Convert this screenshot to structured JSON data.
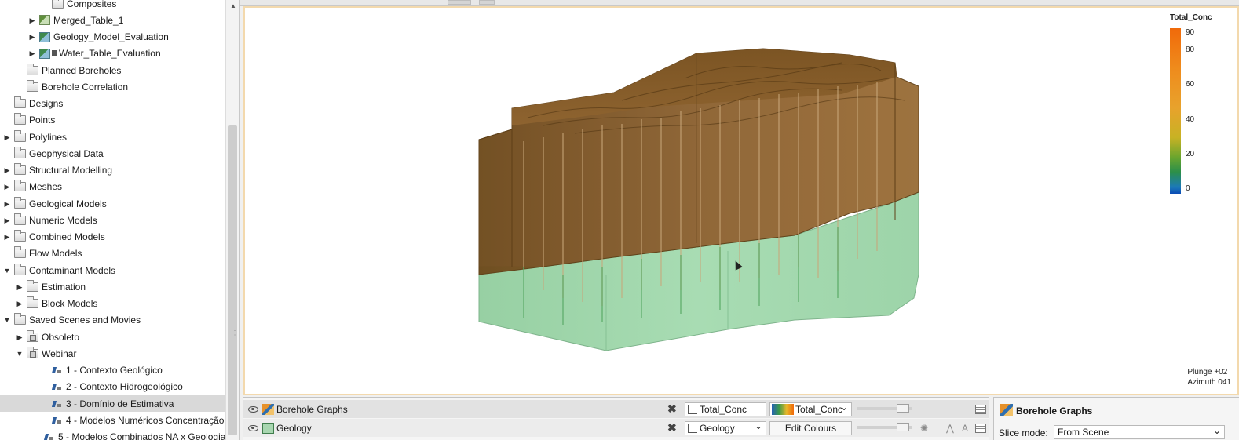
{
  "tree": {
    "items": [
      {
        "label": "Composites",
        "indent": 3,
        "arrow": "",
        "icon": "folder"
      },
      {
        "label": "Merged_Table_1",
        "indent": 2,
        "arrow": "▶",
        "icon": "table"
      },
      {
        "label": "Geology_Model_Evaluation",
        "indent": 2,
        "arrow": "▶",
        "icon": "eval"
      },
      {
        "label": "Water_Table_Evaluation",
        "indent": 2,
        "arrow": "▶",
        "icon": "eval-flag"
      },
      {
        "label": "Planned Boreholes",
        "indent": 1,
        "arrow": "",
        "icon": "folder"
      },
      {
        "label": "Borehole Correlation",
        "indent": 1,
        "arrow": "",
        "icon": "folder"
      },
      {
        "label": "Designs",
        "indent": 0,
        "arrow": "",
        "icon": "folder"
      },
      {
        "label": "Points",
        "indent": 0,
        "arrow": "",
        "icon": "folder"
      },
      {
        "label": "Polylines",
        "indent": 0,
        "arrow": "▶",
        "icon": "folder"
      },
      {
        "label": "Geophysical Data",
        "indent": 0,
        "arrow": "",
        "icon": "folder"
      },
      {
        "label": "Structural Modelling",
        "indent": 0,
        "arrow": "▶",
        "icon": "folder"
      },
      {
        "label": "Meshes",
        "indent": 0,
        "arrow": "▶",
        "icon": "folder"
      },
      {
        "label": "Geological Models",
        "indent": 0,
        "arrow": "▶",
        "icon": "folder"
      },
      {
        "label": "Numeric Models",
        "indent": 0,
        "arrow": "▶",
        "icon": "folder"
      },
      {
        "label": "Combined Models",
        "indent": 0,
        "arrow": "▶",
        "icon": "folder"
      },
      {
        "label": "Flow Models",
        "indent": 0,
        "arrow": "",
        "icon": "folder"
      },
      {
        "label": "Contaminant Models",
        "indent": 0,
        "arrow": "▼",
        "icon": "folder"
      },
      {
        "label": "Estimation",
        "indent": 1,
        "arrow": "▶",
        "icon": "folder"
      },
      {
        "label": "Block Models",
        "indent": 1,
        "arrow": "▶",
        "icon": "folder"
      },
      {
        "label": "Saved Scenes and Movies",
        "indent": 0,
        "arrow": "▼",
        "icon": "folder"
      },
      {
        "label": "Obsoleto",
        "indent": 1,
        "arrow": "▶",
        "icon": "scene-folder"
      },
      {
        "label": "Webinar",
        "indent": 1,
        "arrow": "▼",
        "icon": "scene-folder"
      },
      {
        "label": "1 - Contexto Geológico",
        "indent": 3,
        "arrow": "",
        "icon": "movie"
      },
      {
        "label": "2 - Contexto Hidrogeológico",
        "indent": 3,
        "arrow": "",
        "icon": "movie"
      },
      {
        "label": "3 - Domínio de Estimativa",
        "indent": 3,
        "arrow": "",
        "icon": "movie",
        "selected": true
      },
      {
        "label": "4 - Modelos Numéricos Concentração",
        "indent": 3,
        "arrow": "",
        "icon": "movie"
      },
      {
        "label": "5 - Modelos Combinados NA x Geologia",
        "indent": 3,
        "arrow": "",
        "icon": "movie"
      }
    ]
  },
  "viewport": {
    "legend": {
      "title": "Total_Conc",
      "ticks": [
        "90",
        "80",
        "60",
        "40",
        "20",
        "0"
      ],
      "tick_values": [
        90,
        80,
        60,
        40,
        20,
        0
      ]
    },
    "orientation": {
      "plunge": "Plunge +02",
      "azimuth": "Azimuth 041"
    },
    "colors": {
      "frame": "#f3d9ad",
      "upper_layer": "#8b5a1e",
      "lower_layer": "#9fd6ab"
    }
  },
  "shapes": {
    "rows": [
      {
        "name": "Borehole Graphs",
        "field": "Total_Conc",
        "colour_select": "Total_Conc",
        "icon": "borehole-graphs-icon"
      },
      {
        "name": "Geology",
        "field": "Geology",
        "colour_button": "Edit Colours",
        "icon": "geology-icon"
      }
    ]
  },
  "properties": {
    "title": "Borehole Graphs",
    "slice_mode_label": "Slice mode:",
    "slice_mode_value": "From Scene"
  }
}
